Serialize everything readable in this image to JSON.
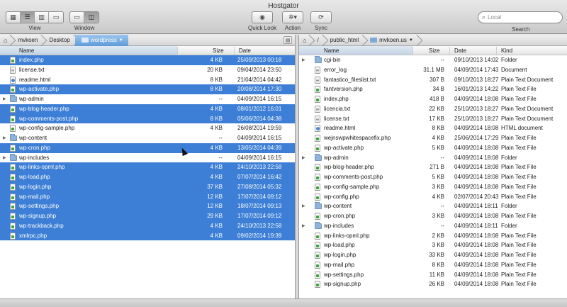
{
  "window": {
    "title": "Hostgator"
  },
  "toolbar": {
    "view_label": "View",
    "window_label": "Window",
    "quicklook_label": "Quick Look",
    "action_label": "Action",
    "sync_label": "Sync",
    "search_label": "Search",
    "search_placeholder": "Local"
  },
  "left": {
    "path": [
      "mvkoen",
      "Desktop",
      "wordpress"
    ],
    "columns": {
      "name": "Name",
      "size": "Size",
      "date": "Date"
    },
    "rows": [
      {
        "name": "index.php",
        "size": "4 KB",
        "date": "25/09/2013 00:18",
        "type": "php",
        "sel": true
      },
      {
        "name": "license.txt",
        "size": "20 KB",
        "date": "09/04/2014 23:50",
        "type": "txt",
        "sel": false
      },
      {
        "name": "readme.html",
        "size": "8 KB",
        "date": "21/04/2014 04:42",
        "type": "html",
        "sel": false
      },
      {
        "name": "wp-activate.php",
        "size": "8 KB",
        "date": "20/08/2014 17:30",
        "type": "php",
        "sel": true
      },
      {
        "name": "wp-admin",
        "size": "--",
        "date": "04/09/2014 16:15",
        "type": "folder",
        "sel": false
      },
      {
        "name": "wp-blog-header.php",
        "size": "4 KB",
        "date": "08/01/2012 16:01",
        "type": "php",
        "sel": true
      },
      {
        "name": "wp-comments-post.php",
        "size": "8 KB",
        "date": "05/06/2014 04:38",
        "type": "php",
        "sel": true
      },
      {
        "name": "wp-config-sample.php",
        "size": "4 KB",
        "date": "26/08/2014 19:59",
        "type": "php",
        "sel": false
      },
      {
        "name": "wp-content",
        "size": "--",
        "date": "04/09/2014 16:15",
        "type": "folder",
        "sel": false
      },
      {
        "name": "wp-cron.php",
        "size": "4 KB",
        "date": "13/05/2014 04:39",
        "type": "php",
        "sel": true
      },
      {
        "name": "wp-includes",
        "size": "--",
        "date": "04/09/2014 16:15",
        "type": "folder",
        "sel": false
      },
      {
        "name": "wp-links-opml.php",
        "size": "4 KB",
        "date": "24/10/2013 22:58",
        "type": "php",
        "sel": true
      },
      {
        "name": "wp-load.php",
        "size": "4 KB",
        "date": "07/07/2014 16:42",
        "type": "php",
        "sel": true
      },
      {
        "name": "wp-login.php",
        "size": "37 KB",
        "date": "27/08/2014 05:32",
        "type": "php",
        "sel": true
      },
      {
        "name": "wp-mail.php",
        "size": "12 KB",
        "date": "17/07/2014 09:12",
        "type": "php",
        "sel": true
      },
      {
        "name": "wp-settings.php",
        "size": "12 KB",
        "date": "18/07/2014 09:13",
        "type": "php",
        "sel": true
      },
      {
        "name": "wp-signup.php",
        "size": "29 KB",
        "date": "17/07/2014 09:12",
        "type": "php",
        "sel": true
      },
      {
        "name": "wp-trackback.php",
        "size": "4 KB",
        "date": "24/10/2013 22:58",
        "type": "php",
        "sel": true
      },
      {
        "name": "xmlrpc.php",
        "size": "4 KB",
        "date": "09/02/2014 19:39",
        "type": "php",
        "sel": true
      }
    ]
  },
  "right": {
    "path": [
      "/",
      "public_html",
      "mvkoen.us"
    ],
    "columns": {
      "name": "Name",
      "size": "Size",
      "date": "Date",
      "kind": "Kind"
    },
    "rows": [
      {
        "name": "cgi-bin",
        "size": "--",
        "date": "09/10/2013 14:02",
        "kind": "Folder",
        "type": "folder"
      },
      {
        "name": "error_log",
        "size": "31.1 MB",
        "date": "04/09/2014 17:43",
        "kind": "Document",
        "type": "txt"
      },
      {
        "name": "fantastico_fileslist.txt",
        "size": "307 B",
        "date": "09/10/2013 18:27",
        "kind": "Plain Text Document",
        "type": "txt"
      },
      {
        "name": "fantversion.php",
        "size": "34 B",
        "date": "16/01/2013 14:22",
        "kind": "Plain Text File",
        "type": "php"
      },
      {
        "name": "index.php",
        "size": "418 B",
        "date": "04/09/2014 18:08",
        "kind": "Plain Text File",
        "type": "php"
      },
      {
        "name": "licencia.txt",
        "size": "22 KB",
        "date": "25/10/2013 18:27",
        "kind": "Plain Text Document",
        "type": "txt"
      },
      {
        "name": "license.txt",
        "size": "17 KB",
        "date": "25/10/2013 18:27",
        "kind": "Plain Text Document",
        "type": "txt"
      },
      {
        "name": "readme.html",
        "size": "8 KB",
        "date": "04/09/2014 18:08",
        "kind": "HTML document",
        "type": "html"
      },
      {
        "name": "wejnswpwhitespacefix.php",
        "size": "4 KB",
        "date": "25/06/2014 17:29",
        "kind": "Plain Text File",
        "type": "php"
      },
      {
        "name": "wp-activate.php",
        "size": "5 KB",
        "date": "04/09/2014 18:08",
        "kind": "Plain Text File",
        "type": "php"
      },
      {
        "name": "wp-admin",
        "size": "--",
        "date": "04/09/2014 18:08",
        "kind": "Folder",
        "type": "folder"
      },
      {
        "name": "wp-blog-header.php",
        "size": "271 B",
        "date": "04/09/2014 18:08",
        "kind": "Plain Text File",
        "type": "php"
      },
      {
        "name": "wp-comments-post.php",
        "size": "5 KB",
        "date": "04/09/2014 18:08",
        "kind": "Plain Text File",
        "type": "php"
      },
      {
        "name": "wp-config-sample.php",
        "size": "3 KB",
        "date": "04/09/2014 18:08",
        "kind": "Plain Text File",
        "type": "php"
      },
      {
        "name": "wp-config.php",
        "size": "4 KB",
        "date": "02/07/2014 20:43",
        "kind": "Plain Text File",
        "type": "php"
      },
      {
        "name": "wp-content",
        "size": "--",
        "date": "04/09/2014 18:11",
        "kind": "Folder",
        "type": "folder"
      },
      {
        "name": "wp-cron.php",
        "size": "3 KB",
        "date": "04/09/2014 18:08",
        "kind": "Plain Text File",
        "type": "php"
      },
      {
        "name": "wp-includes",
        "size": "--",
        "date": "04/09/2014 18:11",
        "kind": "Folder",
        "type": "folder"
      },
      {
        "name": "wp-links-opml.php",
        "size": "2 KB",
        "date": "04/09/2014 18:08",
        "kind": "Plain Text File",
        "type": "php"
      },
      {
        "name": "wp-load.php",
        "size": "3 KB",
        "date": "04/09/2014 18:08",
        "kind": "Plain Text File",
        "type": "php"
      },
      {
        "name": "wp-login.php",
        "size": "33 KB",
        "date": "04/09/2014 18:08",
        "kind": "Plain Text File",
        "type": "php"
      },
      {
        "name": "wp-mail.php",
        "size": "8 KB",
        "date": "04/09/2014 18:08",
        "kind": "Plain Text File",
        "type": "php"
      },
      {
        "name": "wp-settings.php",
        "size": "11 KB",
        "date": "04/09/2014 18:08",
        "kind": "Plain Text File",
        "type": "php"
      },
      {
        "name": "wp-signup.php",
        "size": "26 KB",
        "date": "04/09/2014 18:08",
        "kind": "Plain Text File",
        "type": "php"
      }
    ]
  }
}
